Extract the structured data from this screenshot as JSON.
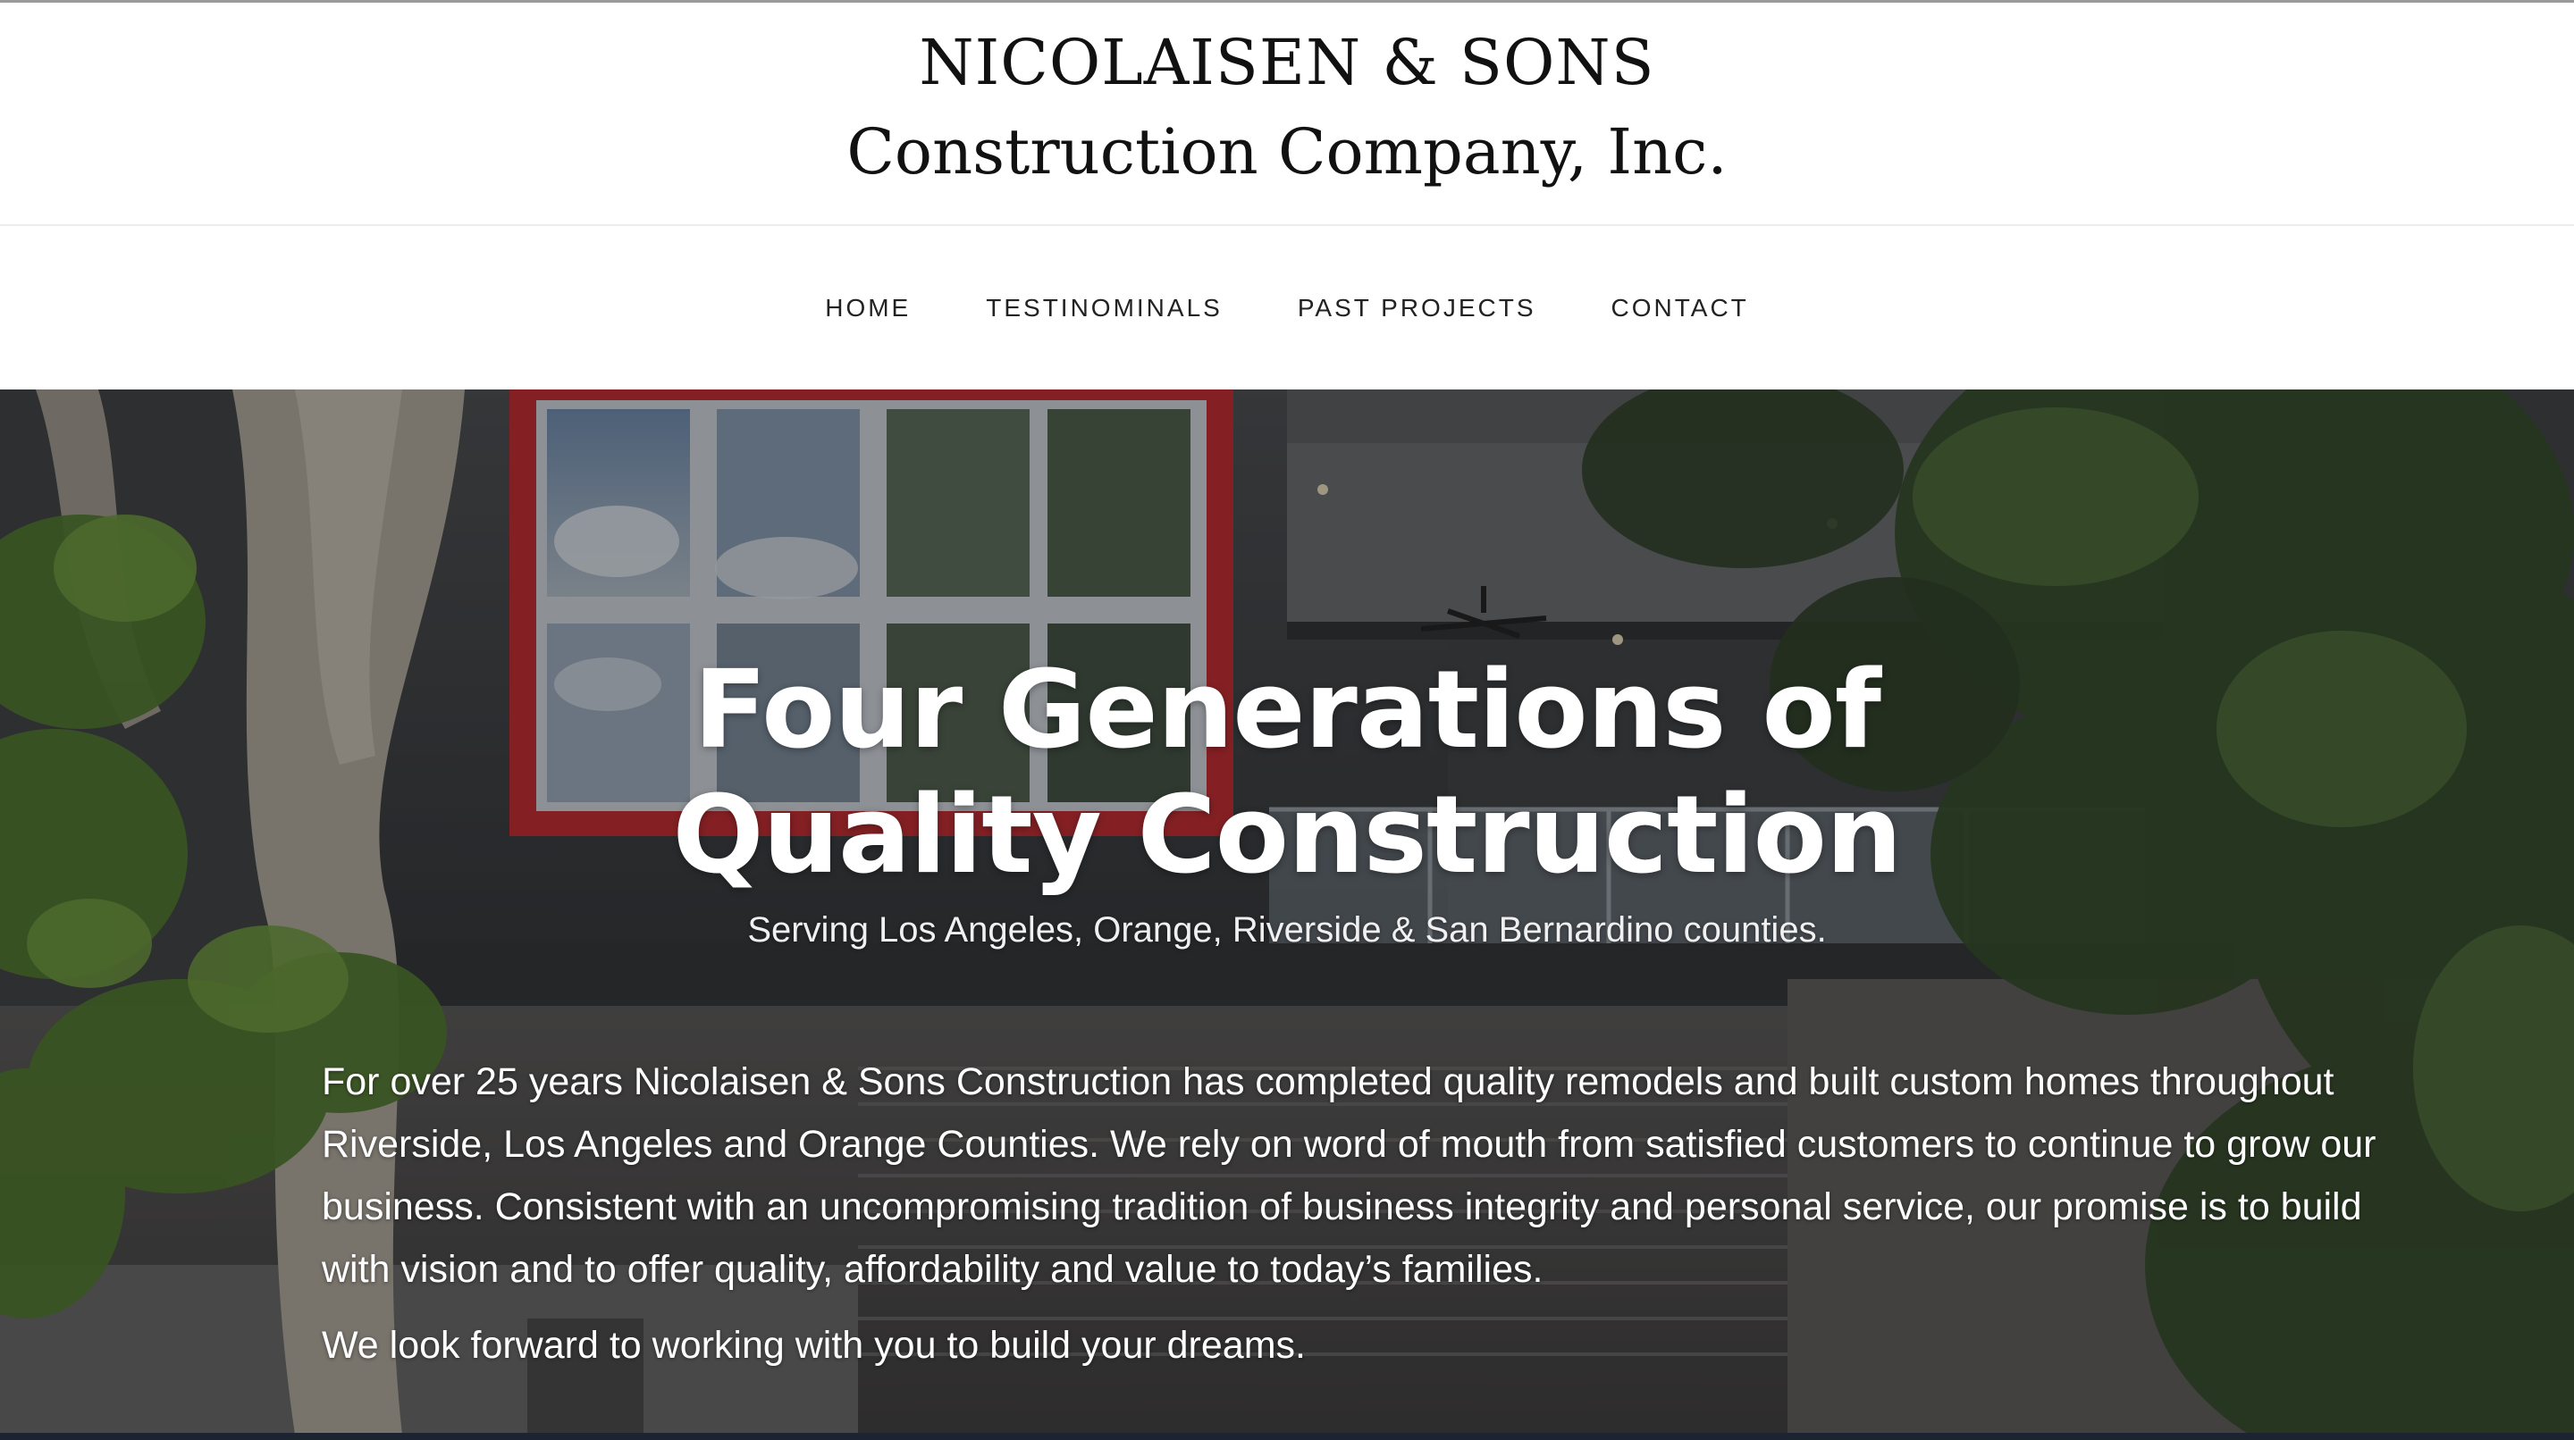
{
  "header": {
    "logo_line1": "NICOLAISEN & SONS",
    "logo_line2": "Construction Company, Inc."
  },
  "nav": {
    "items": [
      {
        "label": "HOME"
      },
      {
        "label": "TESTINOMINALS"
      },
      {
        "label": "PAST PROJECTS"
      },
      {
        "label": "CONTACT"
      }
    ]
  },
  "hero": {
    "title_line1": "Four Generations of",
    "title_line2": "Quality Construction",
    "subtitle": "Serving Los Angeles, Orange, Riverside & San Bernardino counties.",
    "body": "For over 25 years Nicolaisen & Sons Construction has completed quality remodels and built custom homes throughout Riverside, Los Angeles and Orange Counties. We rely on word of mouth from satisfied customers to continue to grow our business. Consistent with an uncompromising tradition of business integrity and personal service, our promise is to build with vision and to offer quality, affordability and value to today’s families.",
    "closing": "We look forward to working with you to build your dreams."
  },
  "colors": {
    "header_background": "#ffffff",
    "logo_text": "#111111",
    "nav_text": "#222222",
    "hero_text": "#ffffff",
    "window_frame_accent": "#c8282c",
    "bottom_bar": "#1b2430"
  }
}
